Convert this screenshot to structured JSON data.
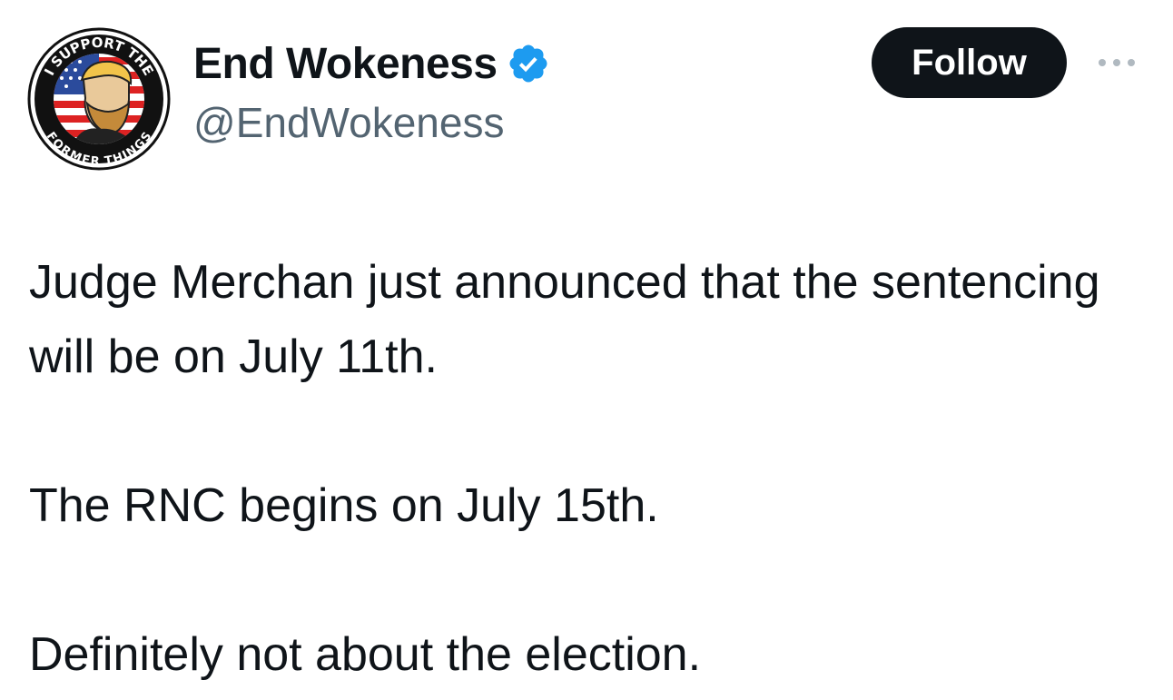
{
  "author": {
    "display_name": "End Wokeness",
    "handle": "@EndWokeness",
    "verified": true,
    "avatar_text_top": "I SUPPORT THE",
    "avatar_text_bottom": "FORMER THINGS"
  },
  "follow_button": {
    "label": "Follow"
  },
  "more_menu": {
    "icon": "more-horizontal-icon"
  },
  "tweet": {
    "paragraphs": [
      "Judge Merchan just announced that the sentencing will be on July 11th.",
      "The RNC begins on July 15th.",
      "Definitely not about the election."
    ]
  },
  "colors": {
    "text_primary": "#0f1419",
    "text_secondary": "#536471",
    "verified_blue": "#1d9bf0",
    "button_bg": "#0f1419",
    "button_text": "#ffffff"
  }
}
